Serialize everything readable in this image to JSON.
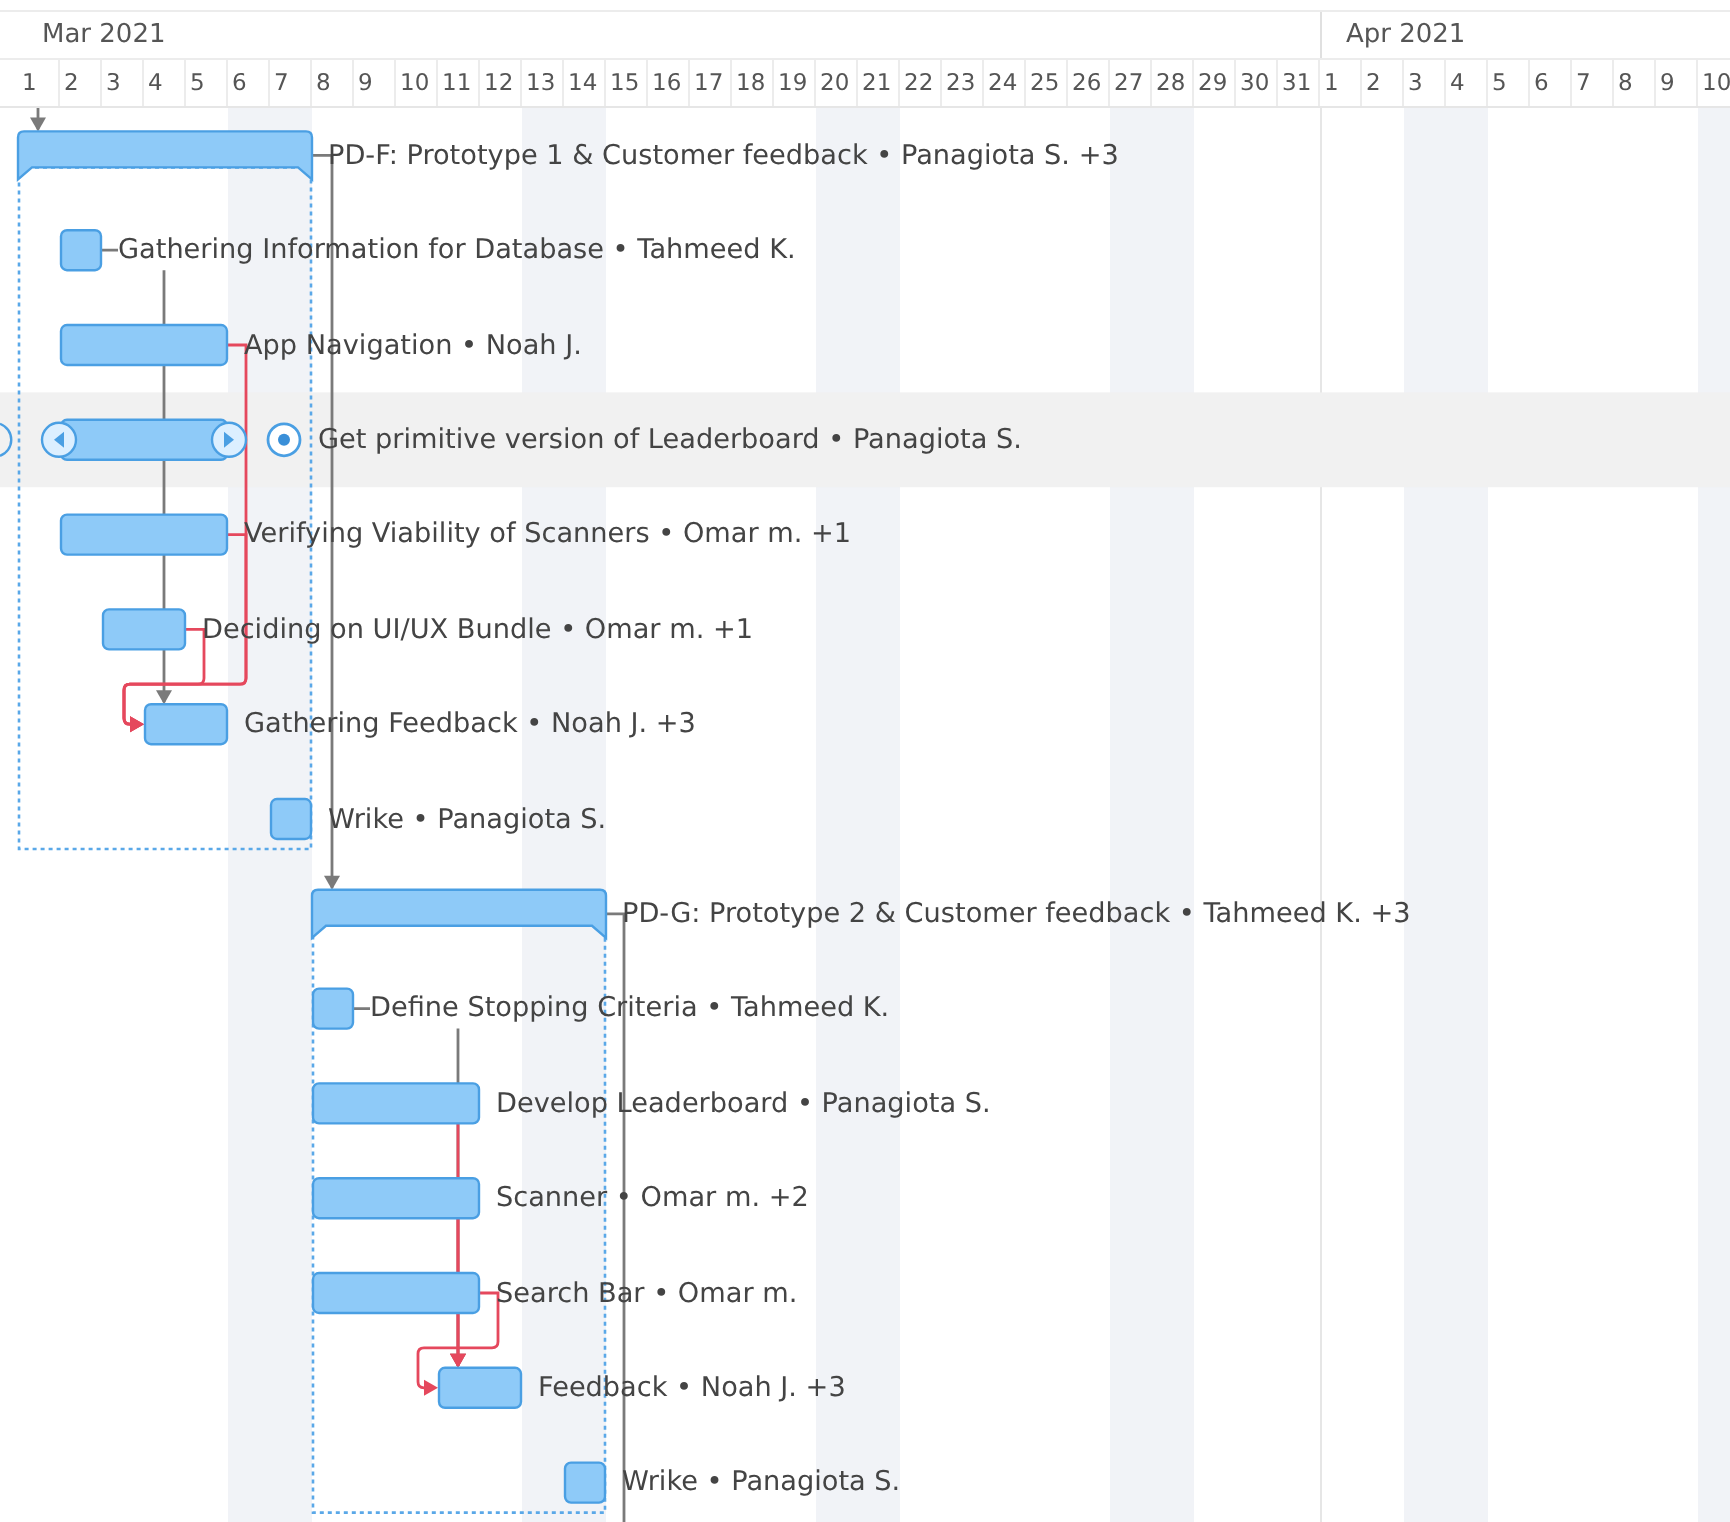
{
  "timeline": {
    "months": [
      {
        "label": "Mar 2021",
        "days": [
          {
            "label": "1",
            "weekend": false
          },
          {
            "label": "2",
            "weekend": false
          },
          {
            "label": "3",
            "weekend": false
          },
          {
            "label": "4",
            "weekend": false
          },
          {
            "label": "5",
            "weekend": false
          },
          {
            "label": "6",
            "weekend": true
          },
          {
            "label": "7",
            "weekend": true
          },
          {
            "label": "8",
            "weekend": false
          },
          {
            "label": "9",
            "weekend": false
          },
          {
            "label": "10",
            "weekend": false
          },
          {
            "label": "11",
            "weekend": false
          },
          {
            "label": "12",
            "weekend": false
          },
          {
            "label": "13",
            "weekend": true
          },
          {
            "label": "14",
            "weekend": true
          },
          {
            "label": "15",
            "weekend": false
          },
          {
            "label": "16",
            "weekend": false
          },
          {
            "label": "17",
            "weekend": false
          },
          {
            "label": "18",
            "weekend": false
          },
          {
            "label": "19",
            "weekend": false
          },
          {
            "label": "20",
            "weekend": true
          },
          {
            "label": "21",
            "weekend": true
          },
          {
            "label": "22",
            "weekend": false
          },
          {
            "label": "23",
            "weekend": false
          },
          {
            "label": "24",
            "weekend": false
          },
          {
            "label": "25",
            "weekend": false
          },
          {
            "label": "26",
            "weekend": false
          },
          {
            "label": "27",
            "weekend": true
          },
          {
            "label": "28",
            "weekend": true
          },
          {
            "label": "29",
            "weekend": false
          },
          {
            "label": "30",
            "weekend": false
          },
          {
            "label": "31",
            "weekend": false
          }
        ]
      },
      {
        "label": "Apr 2021",
        "days": [
          {
            "label": "1",
            "weekend": false
          },
          {
            "label": "2",
            "weekend": false
          },
          {
            "label": "3",
            "weekend": true
          },
          {
            "label": "4",
            "weekend": true
          },
          {
            "label": "5",
            "weekend": false
          },
          {
            "label": "6",
            "weekend": false
          },
          {
            "label": "7",
            "weekend": false
          },
          {
            "label": "8",
            "weekend": false
          },
          {
            "label": "9",
            "weekend": false
          },
          {
            "label": "10",
            "weekend": true
          }
        ]
      }
    ]
  },
  "tasks": [
    {
      "label": "PD-F: Prototype 1 & Customer feedback • Panagiota S. +3",
      "selected": false,
      "children": [
        {
          "label": "Gathering Information for Database • Tahmeed K.",
          "selected": false
        },
        {
          "label": "App Navigation • Noah J.",
          "selected": false
        },
        {
          "label": "Get primitive version of Leaderboard • Panagiota S.",
          "selected": true
        },
        {
          "label": "Verifying Viability of Scanners • Omar m. +1",
          "selected": false
        },
        {
          "label": "Deciding on UI/UX Bundle • Omar m. +1",
          "selected": false
        },
        {
          "label": "Gathering Feedback • Noah J. +3",
          "selected": false
        },
        {
          "label": "Wrike • Panagiota S.",
          "selected": false
        }
      ]
    },
    {
      "label": "PD-G: Prototype 2 & Customer feedback • Tahmeed K. +3",
      "selected": false,
      "children": [
        {
          "label": "Define Stopping Criteria • Tahmeed K.",
          "selected": false
        },
        {
          "label": "Develop Leaderboard • Panagiota S.",
          "selected": false
        },
        {
          "label": "Scanner • Omar m. +2",
          "selected": false
        },
        {
          "label": "Search Bar • Omar m.",
          "selected": false
        },
        {
          "label": "Feedback • Noah J. +3",
          "selected": false
        },
        {
          "label": "Wrike • Panagiota S.",
          "selected": false
        }
      ]
    }
  ]
}
